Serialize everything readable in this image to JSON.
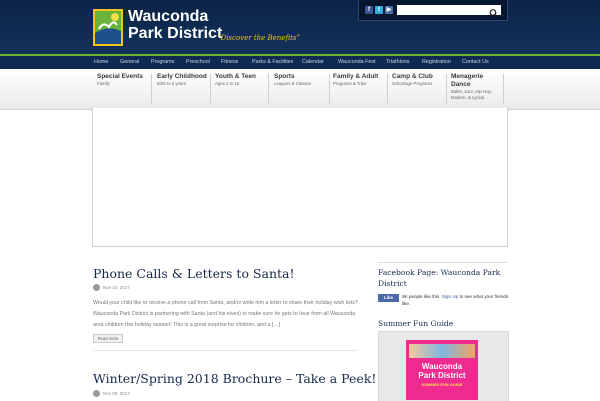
{
  "header": {
    "title_line1": "Wauconda",
    "title_line2": "Park District",
    "tagline": "“Discover the Benefits”",
    "social_icons": [
      "facebook-icon",
      "twitter-icon",
      "youtube-icon"
    ],
    "search_placeholder": ""
  },
  "nav": {
    "items": [
      "Home",
      "General",
      "Programs",
      "Preschool",
      "Fitness",
      "Parks & Facilities",
      "Calendar",
      "Wauconda Fest",
      "Triathlons",
      "Registration",
      "Contact Us"
    ]
  },
  "categories": [
    {
      "title": "Special Events",
      "sub": "Family"
    },
    {
      "title": "Early Childhood",
      "sub": "Birth to 6 years"
    },
    {
      "title": "Youth & Teen",
      "sub": "Ages 4 to 15"
    },
    {
      "title": "Sports",
      "sub": "Leagues & Classes"
    },
    {
      "title": "Family & Adult",
      "sub": "Programs & Trips"
    },
    {
      "title": "Camp & Club",
      "sub": "Schoolage Programs"
    },
    {
      "title_line1": "Menagerie",
      "title_line2": "Dance",
      "sub_line1": "Ballet, Jazz, Hip Hop,",
      "sub_line2": "Modern, & Lyrical"
    }
  ],
  "posts": [
    {
      "title": "Phone Calls & Letters to Santa!",
      "date": "Nov 20, 2017",
      "excerpt": "Would your child like to receive a phone call from Santa, and/or write him a letter to share their holiday wish lists? Wauconda Park District is partnering with Santa (and his elves) to make sure he gets to hear from all Wauconda area children this holiday season! This is a great surprise for children, and a […]",
      "read_more": "Read more"
    },
    {
      "title": "Winter/Spring 2018 Brochure – Take a Peek!",
      "date": "Nov 06, 2017"
    }
  ],
  "sidebar": {
    "facebook_title": "Facebook Page: Wauconda Park District",
    "like_button": "Like",
    "like_text": "9K people like this.",
    "signup_link": "Sign Up",
    "signup_text": "to see what your friends like.",
    "summer_title": "Summer Fun Guide",
    "brochure_title_line1": "Wauconda",
    "brochure_title_line2": "Park District",
    "brochure_sub": "SUMMER FUN GUIDE"
  },
  "colors": {
    "header_bg": "#0b2345",
    "accent_green": "#6fb52c",
    "tagline_gold": "#f0c419",
    "title_navy": "#152a4c"
  }
}
